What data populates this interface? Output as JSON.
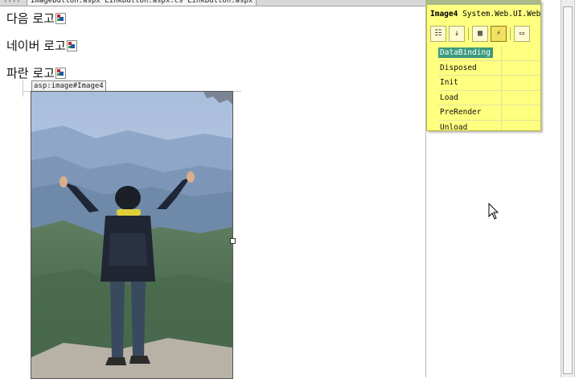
{
  "tabs": [
    {
      "label": "...:",
      "active": false
    },
    {
      "label": "ImageButton.aspx  LinkButton.aspx.cs  LinkButton.aspx",
      "active": true
    }
  ],
  "canvas": {
    "lines": [
      {
        "label": "다음 로고"
      },
      {
        "label": "네이버 로고"
      },
      {
        "label": "파란 로고"
      }
    ],
    "image_tag": "asp:image#Image4"
  },
  "events_popup": {
    "control_id": "Image4",
    "control_type": "System.Web.UI.WebCo",
    "toolbar": [
      "categorized-icon",
      "alphabetical-icon",
      "properties-icon",
      "events-icon",
      "property-pages-icon"
    ],
    "events": [
      "DataBinding",
      "Disposed",
      "Init",
      "Load",
      "PreRender",
      "Unload"
    ],
    "selected_event": "DataBinding",
    "selected_color": "#3b9a7e",
    "background_color": "#ffff80"
  }
}
